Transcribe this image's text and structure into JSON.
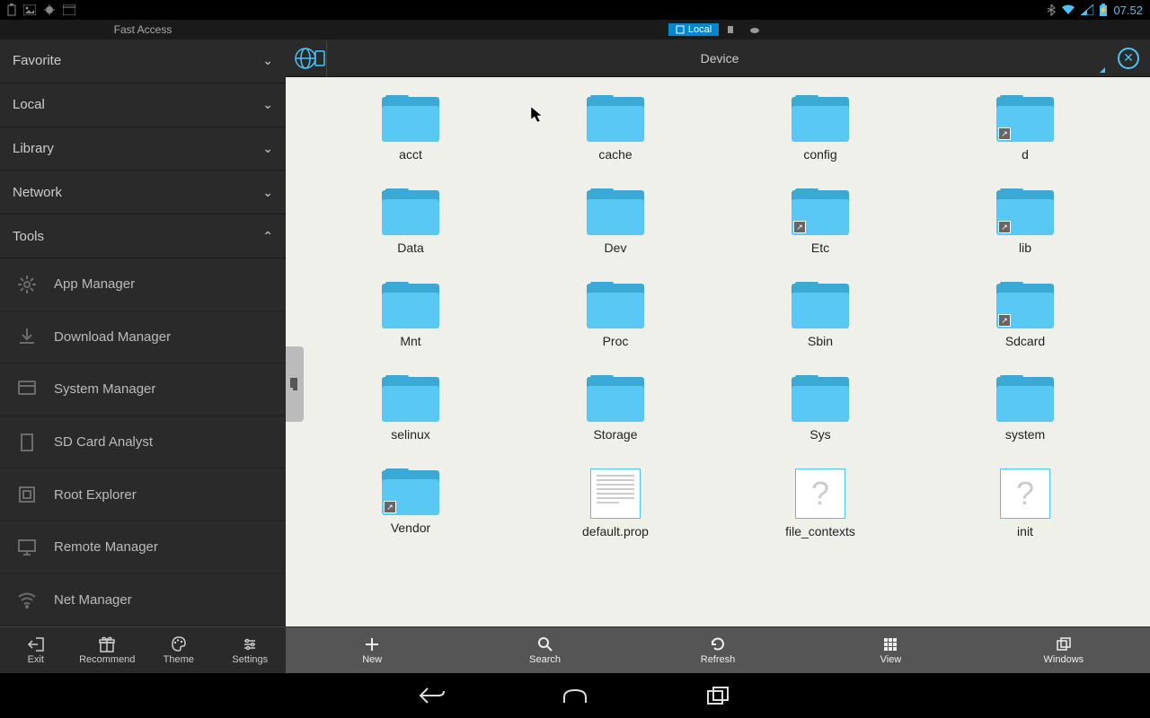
{
  "status_bar": {
    "time": "07.52"
  },
  "sidebar": {
    "header": "Fast Access",
    "sections": [
      {
        "label": "Favorite",
        "expanded": false
      },
      {
        "label": "Local",
        "expanded": false
      },
      {
        "label": "Library",
        "expanded": false
      },
      {
        "label": "Network",
        "expanded": false
      },
      {
        "label": "Tools",
        "expanded": true
      }
    ],
    "tools": [
      {
        "label": "App Manager",
        "icon": "gear"
      },
      {
        "label": "Download Manager",
        "icon": "download"
      },
      {
        "label": "System Manager",
        "icon": "system"
      },
      {
        "label": "SD Card Analyst",
        "icon": "sd"
      },
      {
        "label": "Root Explorer",
        "icon": "root"
      },
      {
        "label": "Remote Manager",
        "icon": "remote"
      },
      {
        "label": "Net Manager",
        "icon": "wifi"
      }
    ],
    "toolbar": [
      {
        "label": "Exit",
        "icon": "exit"
      },
      {
        "label": "Recommend",
        "icon": "gift"
      },
      {
        "label": "Theme",
        "icon": "palette"
      },
      {
        "label": "Settings",
        "icon": "sliders"
      }
    ]
  },
  "location_tabs": {
    "active": "Local"
  },
  "path": {
    "current": "Device"
  },
  "files": [
    {
      "name": "acct",
      "type": "folder",
      "link": false
    },
    {
      "name": "cache",
      "type": "folder",
      "link": false
    },
    {
      "name": "config",
      "type": "folder",
      "link": false
    },
    {
      "name": "d",
      "type": "folder",
      "link": true
    },
    {
      "name": "Data",
      "type": "folder",
      "link": false
    },
    {
      "name": "Dev",
      "type": "folder",
      "link": false
    },
    {
      "name": "Etc",
      "type": "folder",
      "link": true
    },
    {
      "name": "lib",
      "type": "folder",
      "link": true
    },
    {
      "name": "Mnt",
      "type": "folder",
      "link": false
    },
    {
      "name": "Proc",
      "type": "folder",
      "link": false
    },
    {
      "name": "Sbin",
      "type": "folder",
      "link": false
    },
    {
      "name": "Sdcard",
      "type": "folder",
      "link": true
    },
    {
      "name": "selinux",
      "type": "folder",
      "link": false
    },
    {
      "name": "Storage",
      "type": "folder",
      "link": false
    },
    {
      "name": "Sys",
      "type": "folder",
      "link": false
    },
    {
      "name": "system",
      "type": "folder",
      "link": false
    },
    {
      "name": "Vendor",
      "type": "folder",
      "link": true
    },
    {
      "name": "default.prop",
      "type": "doc",
      "link": false
    },
    {
      "name": "file_contexts",
      "type": "unknown",
      "link": false
    },
    {
      "name": "init",
      "type": "unknown",
      "link": false
    }
  ],
  "main_toolbar": [
    {
      "label": "New",
      "icon": "plus"
    },
    {
      "label": "Search",
      "icon": "search"
    },
    {
      "label": "Refresh",
      "icon": "refresh"
    },
    {
      "label": "View",
      "icon": "grid"
    },
    {
      "label": "Windows",
      "icon": "windows"
    }
  ]
}
